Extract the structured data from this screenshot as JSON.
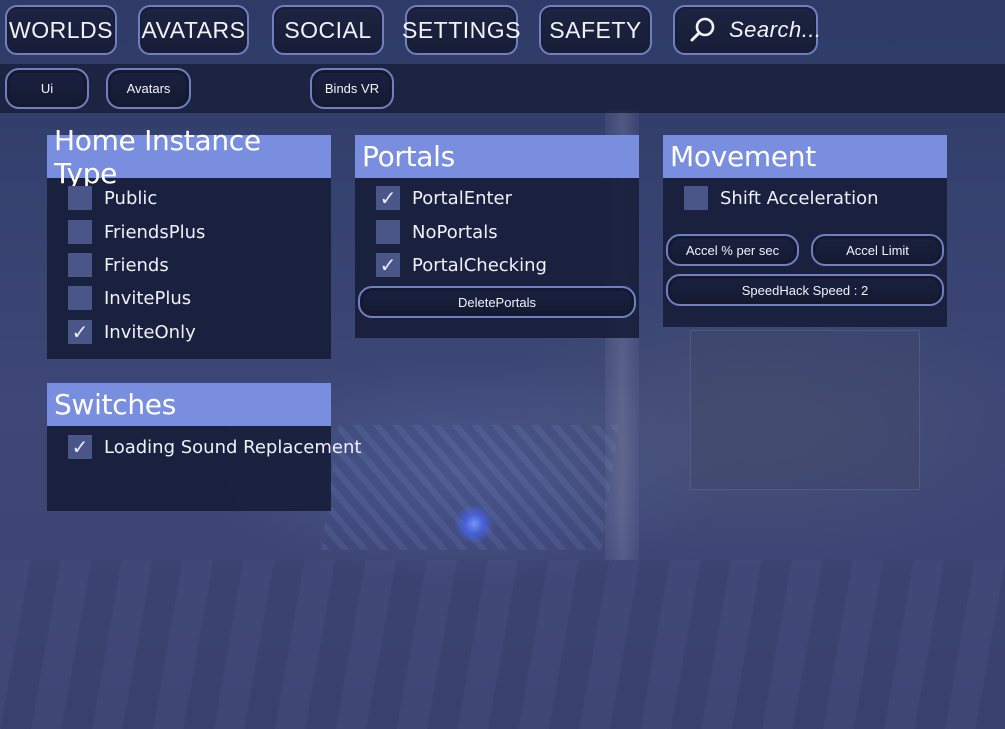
{
  "topnav": {
    "worlds_label": "WORLDS",
    "avatars_label": "AVATARS",
    "social_label": "SOCIAL",
    "settings_label": "SETTINGS",
    "safety_label": "SAFETY",
    "search_label": "Search...",
    "search_icon": "search-icon"
  },
  "subnav": {
    "ui_label": "Ui",
    "avatars_label": "Avatars",
    "binds_label": "Binds VR"
  },
  "home_instance": {
    "title": "Home Instance Type",
    "options": [
      {
        "label": "Public",
        "checked": false
      },
      {
        "label": "FriendsPlus",
        "checked": false
      },
      {
        "label": "Friends",
        "checked": false
      },
      {
        "label": "InvitePlus",
        "checked": false
      },
      {
        "label": "InviteOnly",
        "checked": true
      }
    ]
  },
  "switches": {
    "title": "Switches",
    "options": [
      {
        "label": "Loading Sound Replacement",
        "checked": true
      }
    ]
  },
  "portals": {
    "title": "Portals",
    "options": [
      {
        "label": "PortalEnter",
        "checked": true
      },
      {
        "label": "NoPortals",
        "checked": false
      },
      {
        "label": "PortalChecking",
        "checked": true
      }
    ],
    "delete_label": "DeletePortals"
  },
  "movement": {
    "title": "Movement",
    "options": [
      {
        "label": "Shift Acceleration",
        "checked": false
      }
    ],
    "accel_label": "Accel % per sec",
    "accel_limit_label": "Accel Limit",
    "speedhack_label": "SpeedHack Speed : 2"
  },
  "colors": {
    "header_bg": "#7a8ee0",
    "panel_bg": "#161d38",
    "checkbox_bg": "#4b5688",
    "button_border": "#6f7fc2"
  }
}
